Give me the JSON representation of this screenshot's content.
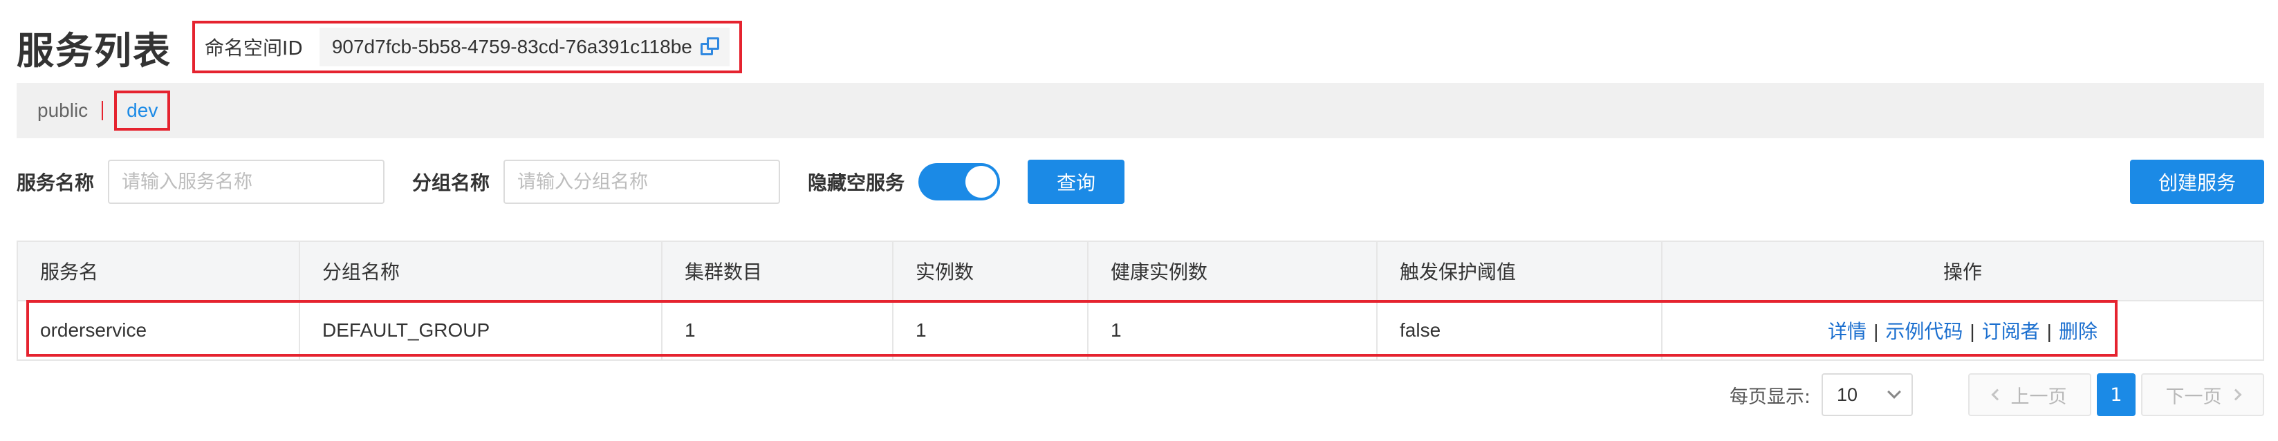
{
  "page": {
    "title": "服务列表"
  },
  "namespace": {
    "label": "命名空间ID",
    "id": "907d7fcb-5b58-4759-83cd-76a391c118be",
    "tabs": [
      {
        "label": "public",
        "active": false
      },
      {
        "label": "dev",
        "active": true
      }
    ]
  },
  "filters": {
    "service_name_label": "服务名称",
    "service_name_placeholder": "请输入服务名称",
    "group_name_label": "分组名称",
    "group_name_placeholder": "请输入分组名称",
    "hide_empty_label": "隐藏空服务",
    "hide_empty_on": true,
    "query_button": "查询",
    "create_button": "创建服务"
  },
  "table": {
    "columns": [
      "服务名",
      "分组名称",
      "集群数目",
      "实例数",
      "健康实例数",
      "触发保护阈值",
      "操作"
    ],
    "rows": [
      {
        "service": "orderservice",
        "group": "DEFAULT_GROUP",
        "clusters": "1",
        "instances": "1",
        "healthy": "1",
        "threshold": "false",
        "actions": [
          "详情",
          "示例代码",
          "订阅者",
          "删除"
        ]
      }
    ]
  },
  "pagination": {
    "page_size_label": "每页显示:",
    "page_size": "10",
    "prev": "上一页",
    "current_page": "1",
    "next": "下一页"
  },
  "colors": {
    "primary": "#1b8ae6",
    "highlight": "#e5232f",
    "link": "#1b6fcf"
  }
}
